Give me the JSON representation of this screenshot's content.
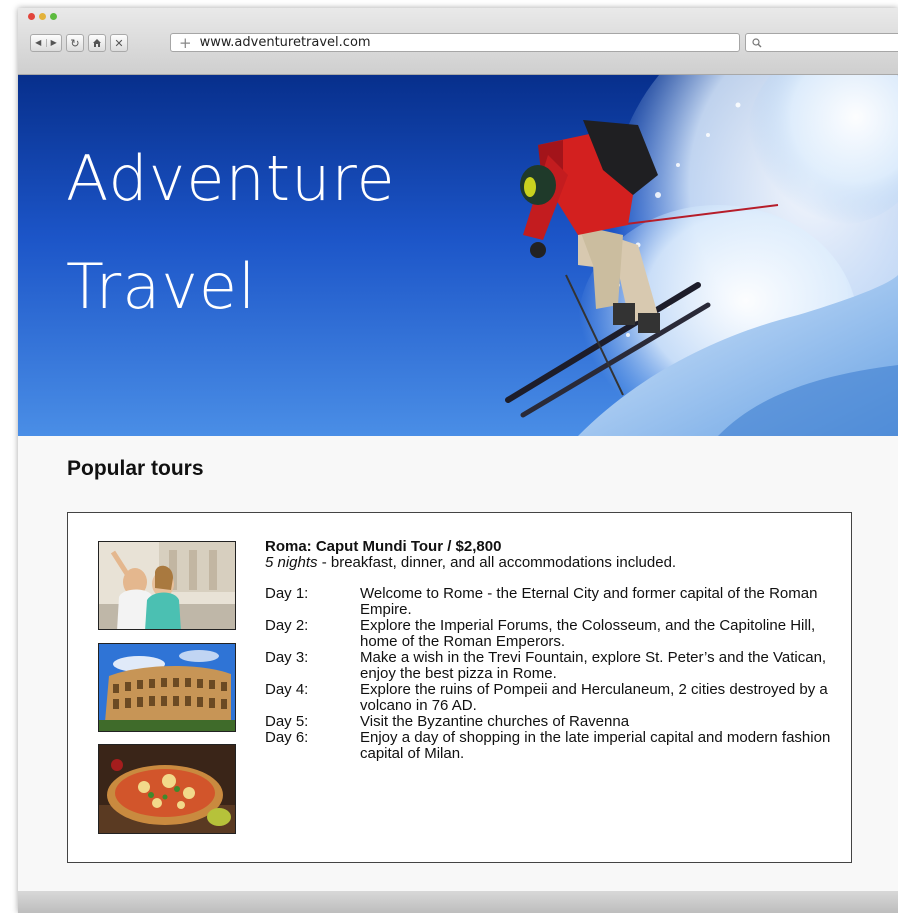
{
  "browser": {
    "url": "www.adventuretravel.com",
    "controls": {
      "back_icon": "back-arrow-icon",
      "forward_icon": "forward-arrow-icon",
      "reload_icon": "reload-icon",
      "home_icon": "home-icon",
      "stop_icon": "stop-icon",
      "new_tab_icon": "plus-icon",
      "search_icon": "magnifier-icon"
    }
  },
  "hero": {
    "title_line1": "Adventure",
    "title_line2": "Travel"
  },
  "section": {
    "heading": "Popular tours"
  },
  "tour": {
    "title": "Roma: Caput Mundi Tour / $2,800",
    "nights": "5 nights",
    "includes": " - breakfast, dinner, and all accommodations included.",
    "days": [
      {
        "label": "Day 1:",
        "desc": "Welcome to Rome - the Eternal City and former capital of the Roman Empire."
      },
      {
        "label": "Day 2:",
        "desc": "Explore the Imperial Forums, the Colosseum, and the Capitoline Hill, home of the Roman Emperors."
      },
      {
        "label": "Day 3:",
        "desc": "Make a wish in the Trevi Fountain, explore St. Peter’s and the Vatican, enjoy the best pizza in Rome."
      },
      {
        "label": "Day 4:",
        "desc": "Explore the ruins of Pompeii and Herculaneum, 2 cities destroyed by a volcano in 76 AD."
      },
      {
        "label": "Day 5:",
        "desc": "Visit the Byzantine churches of Ravenna"
      },
      {
        "label": "Day 6:",
        "desc": "Enjoy a day of shopping in the late imperial capital and modern fashion capital of Milan."
      }
    ]
  },
  "colors": {
    "sky_top": "#072f8c",
    "sky_bottom": "#4a8ee6",
    "jacket": "#d3201f"
  }
}
